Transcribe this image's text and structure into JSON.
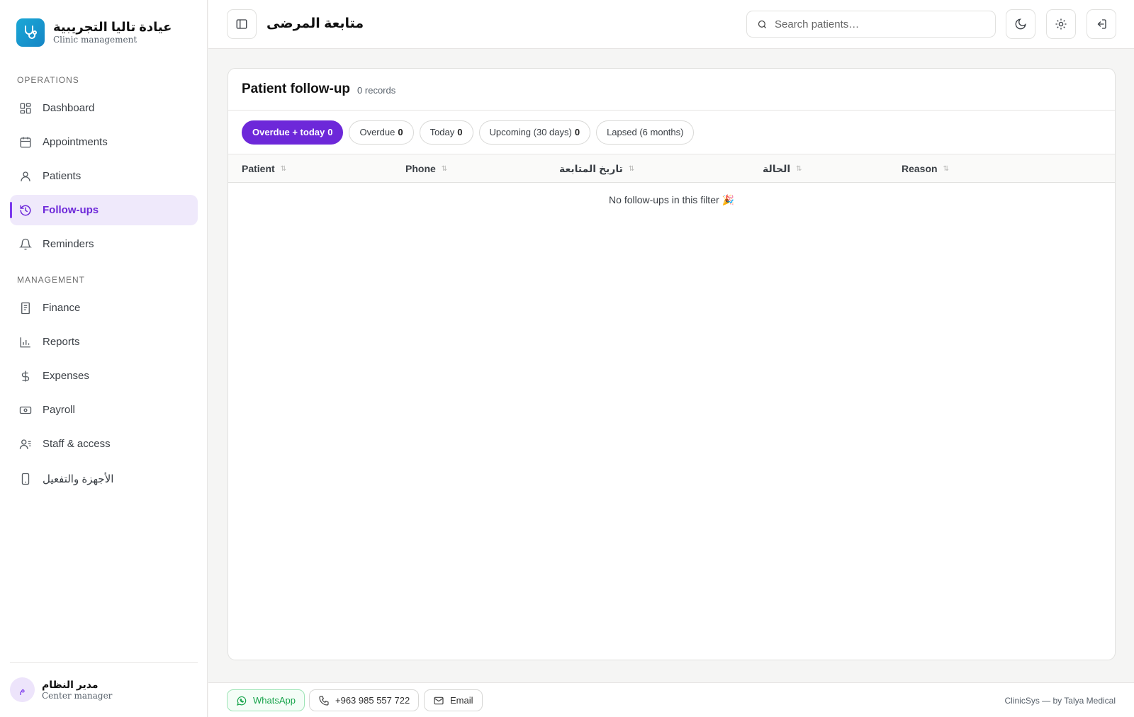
{
  "brand": {
    "name": "عيادة تاليا التجريبية",
    "subtitle": "Clinic management"
  },
  "sidebar": {
    "sections": [
      {
        "label": "OPERATIONS"
      },
      {
        "label": "MANAGEMENT"
      }
    ],
    "items": [
      {
        "label": "Dashboard",
        "icon": "dashboard-grid-icon"
      },
      {
        "label": "Appointments",
        "icon": "calendar-icon"
      },
      {
        "label": "Patients",
        "icon": "user-icon"
      },
      {
        "label": "Follow-ups",
        "icon": "history-clock-icon",
        "active": true
      },
      {
        "label": "Reminders",
        "icon": "bell-icon"
      },
      {
        "label": "Finance",
        "icon": "receipt-icon"
      },
      {
        "label": "Reports",
        "icon": "bar-chart-icon"
      },
      {
        "label": "Expenses",
        "icon": "dollar-icon"
      },
      {
        "label": "Payroll",
        "icon": "banknote-icon"
      },
      {
        "label": "Staff & access",
        "icon": "users-list-icon"
      },
      {
        "label": "الأجهزة والتفعيل",
        "icon": "smartphone-icon"
      }
    ]
  },
  "user": {
    "initial": "م",
    "name": "مدير النظام",
    "role": "Center manager"
  },
  "topbar": {
    "title": "متابعة المرضى",
    "search_placeholder": "Search patients…"
  },
  "card": {
    "title": "Patient follow-up",
    "count": "0 records",
    "filters": [
      {
        "label": "Overdue + today",
        "count": "0",
        "active": true
      },
      {
        "label": "Overdue",
        "count": "0"
      },
      {
        "label": "Today",
        "count": "0"
      },
      {
        "label": "Upcoming (30 days)",
        "count": "0"
      },
      {
        "label": "Lapsed (6 months)",
        "count": ""
      }
    ],
    "columns": [
      "Patient",
      "Phone",
      "تاريخ المتابعة",
      "الحالة",
      "Reason"
    ],
    "empty_text": "No follow-ups in this filter 🎉"
  },
  "footer": {
    "whatsapp": "WhatsApp",
    "phone": "+963 985 557 722",
    "email": "Email",
    "copyright": "ClinicSys — by Talya Medical"
  },
  "colors": {
    "accent": "#6d28d9",
    "active_bg": "#efe9fb",
    "brand_logo": "#1b9ed4",
    "whatsapp": "#16a34a"
  }
}
